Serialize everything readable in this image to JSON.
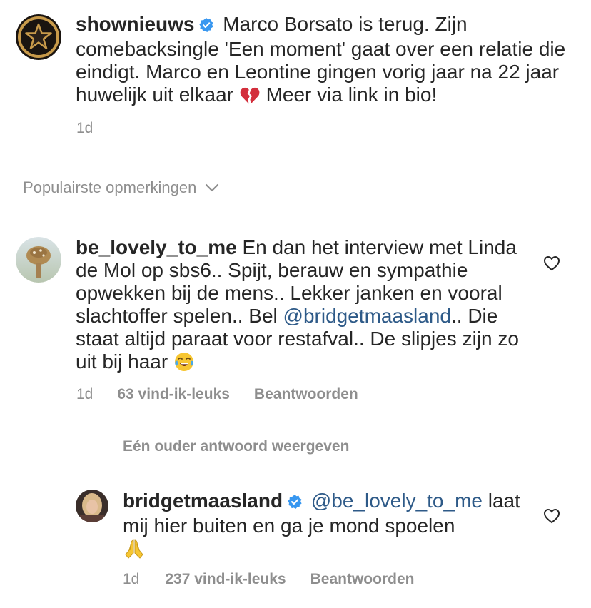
{
  "post": {
    "username": "shownieuws",
    "caption_text": "Marco Borsato is terug. Zijn comebacksingle 'Een moment' gaat over een relatie die eindigt. Marco en Leontine gingen vorig jaar na 22 jaar huwelijk uit elkaar",
    "caption_emoji": "broken-heart-emoji",
    "caption_tail": "Meer via link in bio!",
    "time": "1d"
  },
  "sort": {
    "label": "Populairste opmerkingen",
    "icon": "chevron-down-icon"
  },
  "comments": [
    {
      "username": "be_lovely_to_me",
      "text_before": "En dan het interview met Linda de Mol op sbs6.. Spijt, berauw en sympathie opwekken bij de mens.. Lekker janken en vooral slachtoffer spelen.. Bel",
      "mention": "@bridgetmaasland",
      "text_after": ".. Die staat altijd paraat voor restafval.. De slipjes zijn zo uit bij haar",
      "emoji": "tears-of-joy-emoji",
      "time": "1d",
      "likes": "63 vind-ik-leuks",
      "reply": "Beantwoorden"
    },
    {
      "username": "bridgetmaasland",
      "verified": true,
      "mention": "@be_lovely_to_me",
      "text_after": "laat mij hier buiten en ga je mond spoelen",
      "emoji": "folded-hands-emoji",
      "time": "1d",
      "likes": "237 vind-ik-leuks",
      "reply": "Beantwoorden"
    }
  ],
  "view_older_replies": "Eén ouder antwoord weergeven",
  "colors": {
    "text": "#262626",
    "secondary": "#8e8e8e",
    "mention": "#2e5a88",
    "verified": "#3897f0",
    "divider": "#dbdbdb"
  }
}
